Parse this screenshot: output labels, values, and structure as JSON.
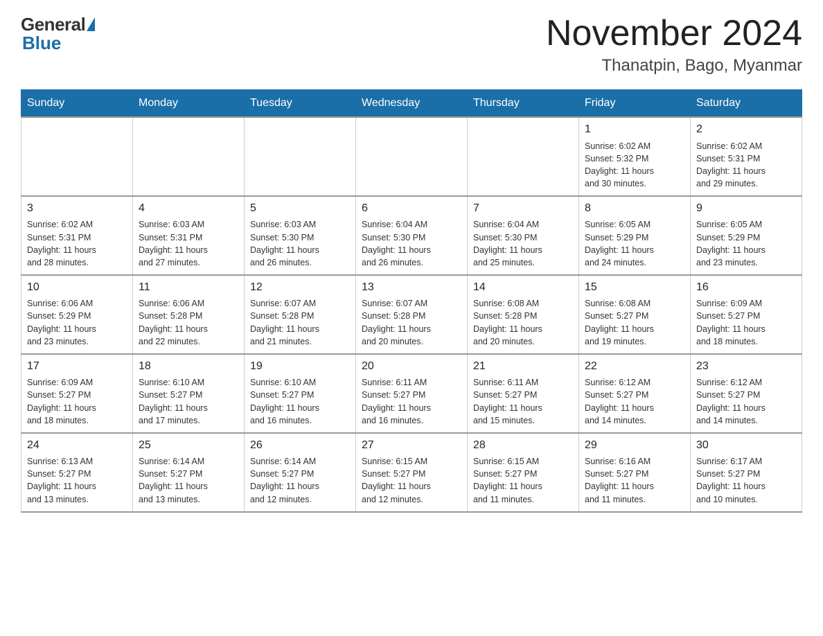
{
  "header": {
    "logo_general": "General",
    "logo_blue": "Blue",
    "month_title": "November 2024",
    "location": "Thanatpin, Bago, Myanmar"
  },
  "days_of_week": [
    "Sunday",
    "Monday",
    "Tuesday",
    "Wednesday",
    "Thursday",
    "Friday",
    "Saturday"
  ],
  "weeks": [
    [
      {
        "day": "",
        "info": ""
      },
      {
        "day": "",
        "info": ""
      },
      {
        "day": "",
        "info": ""
      },
      {
        "day": "",
        "info": ""
      },
      {
        "day": "",
        "info": ""
      },
      {
        "day": "1",
        "info": "Sunrise: 6:02 AM\nSunset: 5:32 PM\nDaylight: 11 hours\nand 30 minutes."
      },
      {
        "day": "2",
        "info": "Sunrise: 6:02 AM\nSunset: 5:31 PM\nDaylight: 11 hours\nand 29 minutes."
      }
    ],
    [
      {
        "day": "3",
        "info": "Sunrise: 6:02 AM\nSunset: 5:31 PM\nDaylight: 11 hours\nand 28 minutes."
      },
      {
        "day": "4",
        "info": "Sunrise: 6:03 AM\nSunset: 5:31 PM\nDaylight: 11 hours\nand 27 minutes."
      },
      {
        "day": "5",
        "info": "Sunrise: 6:03 AM\nSunset: 5:30 PM\nDaylight: 11 hours\nand 26 minutes."
      },
      {
        "day": "6",
        "info": "Sunrise: 6:04 AM\nSunset: 5:30 PM\nDaylight: 11 hours\nand 26 minutes."
      },
      {
        "day": "7",
        "info": "Sunrise: 6:04 AM\nSunset: 5:30 PM\nDaylight: 11 hours\nand 25 minutes."
      },
      {
        "day": "8",
        "info": "Sunrise: 6:05 AM\nSunset: 5:29 PM\nDaylight: 11 hours\nand 24 minutes."
      },
      {
        "day": "9",
        "info": "Sunrise: 6:05 AM\nSunset: 5:29 PM\nDaylight: 11 hours\nand 23 minutes."
      }
    ],
    [
      {
        "day": "10",
        "info": "Sunrise: 6:06 AM\nSunset: 5:29 PM\nDaylight: 11 hours\nand 23 minutes."
      },
      {
        "day": "11",
        "info": "Sunrise: 6:06 AM\nSunset: 5:28 PM\nDaylight: 11 hours\nand 22 minutes."
      },
      {
        "day": "12",
        "info": "Sunrise: 6:07 AM\nSunset: 5:28 PM\nDaylight: 11 hours\nand 21 minutes."
      },
      {
        "day": "13",
        "info": "Sunrise: 6:07 AM\nSunset: 5:28 PM\nDaylight: 11 hours\nand 20 minutes."
      },
      {
        "day": "14",
        "info": "Sunrise: 6:08 AM\nSunset: 5:28 PM\nDaylight: 11 hours\nand 20 minutes."
      },
      {
        "day": "15",
        "info": "Sunrise: 6:08 AM\nSunset: 5:27 PM\nDaylight: 11 hours\nand 19 minutes."
      },
      {
        "day": "16",
        "info": "Sunrise: 6:09 AM\nSunset: 5:27 PM\nDaylight: 11 hours\nand 18 minutes."
      }
    ],
    [
      {
        "day": "17",
        "info": "Sunrise: 6:09 AM\nSunset: 5:27 PM\nDaylight: 11 hours\nand 18 minutes."
      },
      {
        "day": "18",
        "info": "Sunrise: 6:10 AM\nSunset: 5:27 PM\nDaylight: 11 hours\nand 17 minutes."
      },
      {
        "day": "19",
        "info": "Sunrise: 6:10 AM\nSunset: 5:27 PM\nDaylight: 11 hours\nand 16 minutes."
      },
      {
        "day": "20",
        "info": "Sunrise: 6:11 AM\nSunset: 5:27 PM\nDaylight: 11 hours\nand 16 minutes."
      },
      {
        "day": "21",
        "info": "Sunrise: 6:11 AM\nSunset: 5:27 PM\nDaylight: 11 hours\nand 15 minutes."
      },
      {
        "day": "22",
        "info": "Sunrise: 6:12 AM\nSunset: 5:27 PM\nDaylight: 11 hours\nand 14 minutes."
      },
      {
        "day": "23",
        "info": "Sunrise: 6:12 AM\nSunset: 5:27 PM\nDaylight: 11 hours\nand 14 minutes."
      }
    ],
    [
      {
        "day": "24",
        "info": "Sunrise: 6:13 AM\nSunset: 5:27 PM\nDaylight: 11 hours\nand 13 minutes."
      },
      {
        "day": "25",
        "info": "Sunrise: 6:14 AM\nSunset: 5:27 PM\nDaylight: 11 hours\nand 13 minutes."
      },
      {
        "day": "26",
        "info": "Sunrise: 6:14 AM\nSunset: 5:27 PM\nDaylight: 11 hours\nand 12 minutes."
      },
      {
        "day": "27",
        "info": "Sunrise: 6:15 AM\nSunset: 5:27 PM\nDaylight: 11 hours\nand 12 minutes."
      },
      {
        "day": "28",
        "info": "Sunrise: 6:15 AM\nSunset: 5:27 PM\nDaylight: 11 hours\nand 11 minutes."
      },
      {
        "day": "29",
        "info": "Sunrise: 6:16 AM\nSunset: 5:27 PM\nDaylight: 11 hours\nand 11 minutes."
      },
      {
        "day": "30",
        "info": "Sunrise: 6:17 AM\nSunset: 5:27 PM\nDaylight: 11 hours\nand 10 minutes."
      }
    ]
  ]
}
